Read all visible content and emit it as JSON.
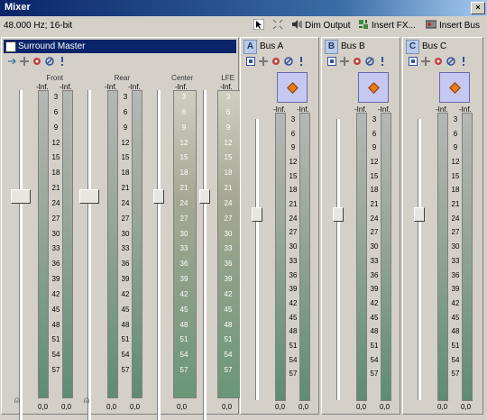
{
  "window": {
    "title": "Mixer",
    "close": "×"
  },
  "toolbar": {
    "format": "48.000 Hz; 16-bit",
    "dim_output": "Dim Output",
    "insert_fx": "Insert FX...",
    "insert_bus": "Insert Bus"
  },
  "master": {
    "name": "Surround Master",
    "channels": [
      {
        "label": "Front",
        "peaks": [
          "-Inf.",
          "-Inf."
        ],
        "values": [
          "0,0",
          "0,0"
        ]
      },
      {
        "label": "Rear",
        "peaks": [
          "-Inf.",
          "-Inf."
        ],
        "values": [
          "0,0",
          "0,0"
        ]
      },
      {
        "label": "Center",
        "peaks": [
          "-Inf."
        ],
        "values": [
          "0,0"
        ]
      },
      {
        "label": "LFE",
        "peaks": [
          "-Inf."
        ],
        "values": [
          "0,0"
        ]
      }
    ]
  },
  "buses": [
    {
      "letter": "A",
      "name": "Bus A",
      "peaks": [
        "-Inf.",
        "-Inf."
      ],
      "values": [
        "0,0",
        "0,0"
      ]
    },
    {
      "letter": "B",
      "name": "Bus B",
      "peaks": [
        "-Inf.",
        "-Inf."
      ],
      "values": [
        "0,0",
        "0,0"
      ]
    },
    {
      "letter": "C",
      "name": "Bus C",
      "peaks": [
        "-Inf.",
        "-Inf."
      ],
      "values": [
        "0,0",
        "0,0"
      ]
    }
  ],
  "scale": [
    "3",
    "6",
    "9",
    "12",
    "15",
    "18",
    "21",
    "24",
    "27",
    "30",
    "33",
    "36",
    "39",
    "42",
    "45",
    "48",
    "51",
    "54",
    "57"
  ]
}
